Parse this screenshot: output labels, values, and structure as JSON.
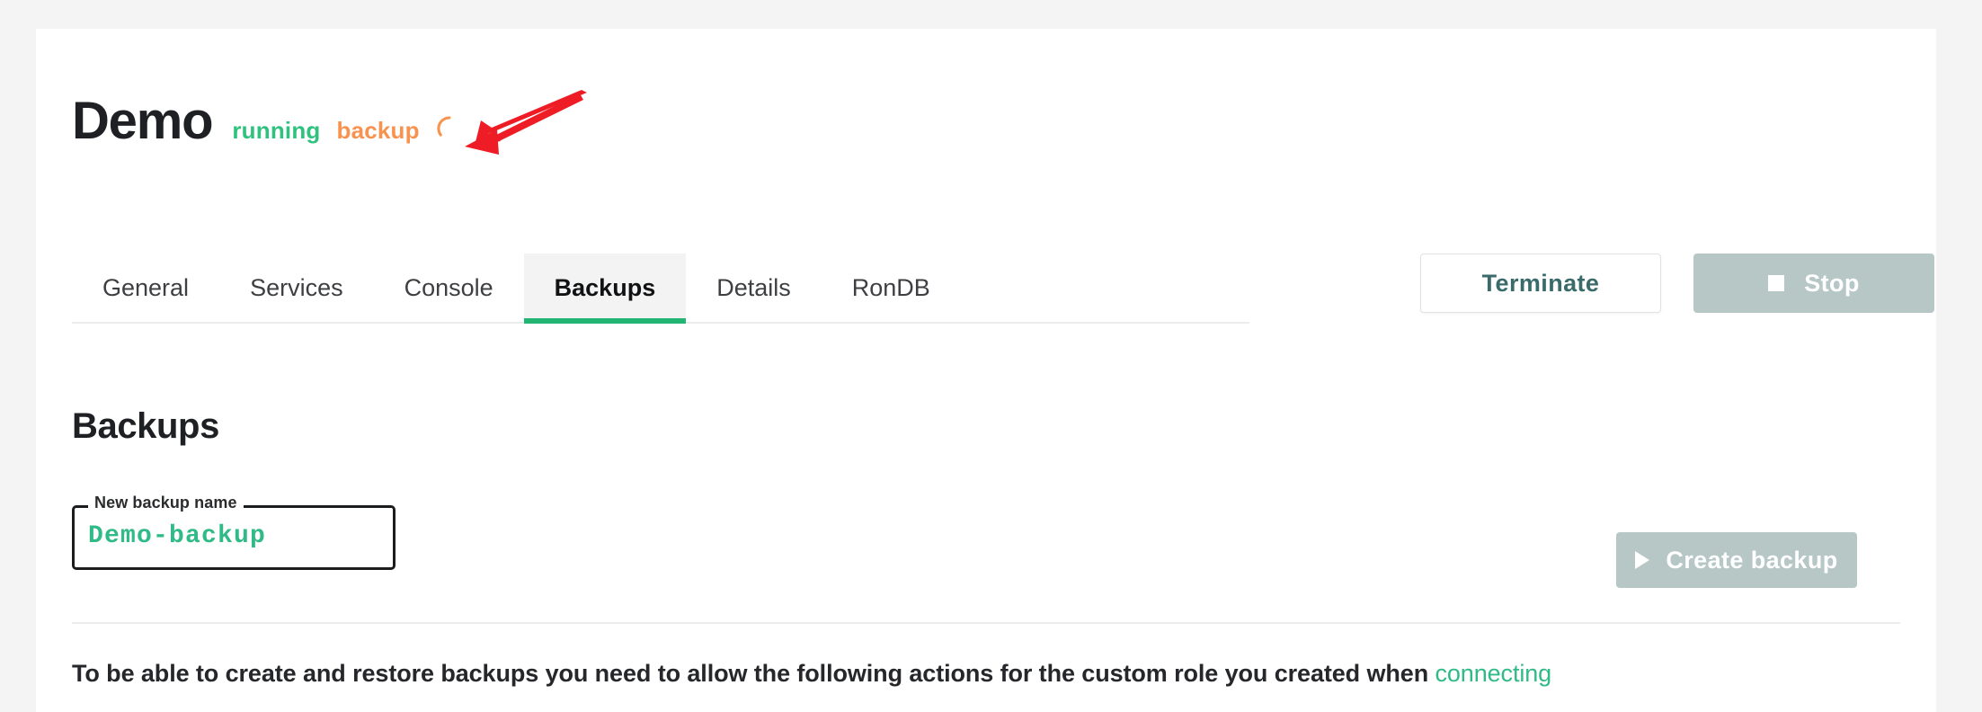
{
  "header": {
    "cluster_name": "Demo",
    "status": "running",
    "operation": "backup",
    "spinner_icon": "loading-spinner-icon",
    "spinner_color": "#f8924f",
    "status_color": "#2ec27e"
  },
  "annotation": {
    "arrow_icon": "red-arrow-pointer-icon",
    "arrow_color": "#ee1c24"
  },
  "tabs": [
    {
      "label": "General",
      "active": false
    },
    {
      "label": "Services",
      "active": false
    },
    {
      "label": "Console",
      "active": false
    },
    {
      "label": "Backups",
      "active": true
    },
    {
      "label": "Details",
      "active": false
    },
    {
      "label": "RonDB",
      "active": false
    }
  ],
  "header_actions": {
    "terminate_label": "Terminate",
    "stop_label": "Stop",
    "stop_icon": "stop-square-icon"
  },
  "main": {
    "section_title": "Backups",
    "new_backup_field": {
      "label": "New backup name",
      "value": "Demo-backup",
      "placeholder": "New backup name"
    },
    "create_backup_label": "Create backup",
    "create_backup_icon": "play-triangle-icon",
    "note_text": "To be able to create and restore backups you need to allow the following actions for the custom role you created when ",
    "note_link": "connecting"
  },
  "colors": {
    "accent_green": "#22b573",
    "value_green": "#2fba87",
    "orange": "#f8924f",
    "disabled_button": "#b6c7c6",
    "page_background": "#f4f4f4",
    "card_background": "#ffffff"
  }
}
